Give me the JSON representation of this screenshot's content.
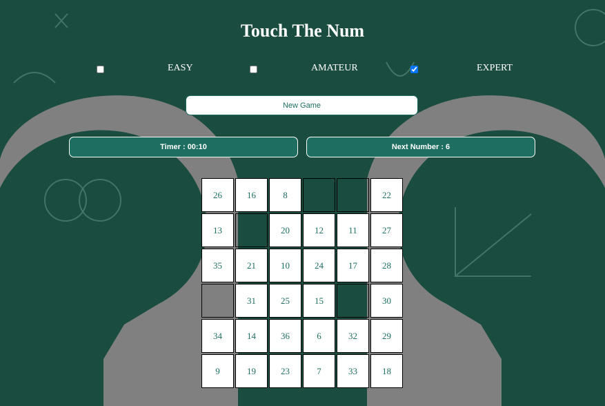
{
  "title": "Touch The Num",
  "levels": [
    {
      "label": "EASY",
      "checked": false
    },
    {
      "label": "AMATEUR",
      "checked": false
    },
    {
      "label": "EXPERT",
      "checked": true
    }
  ],
  "new_game_label": "New Game",
  "timer_label": "Timer : 00:10",
  "next_number_label": "Next Number : 6",
  "colors": {
    "accent": "#1e6e62",
    "board": "#1b4c40",
    "head": "#808080"
  },
  "grid": {
    "columns": 6,
    "cells": [
      "26",
      "16",
      "8",
      "",
      "",
      "22",
      "13",
      "",
      "20",
      "12",
      "11",
      "27",
      "35",
      "21",
      "10",
      "24",
      "17",
      "28",
      "",
      "31",
      "25",
      "15",
      "",
      "30",
      "34",
      "14",
      "36",
      "6",
      "32",
      "29",
      "9",
      "19",
      "23",
      "7",
      "33",
      "18"
    ]
  }
}
